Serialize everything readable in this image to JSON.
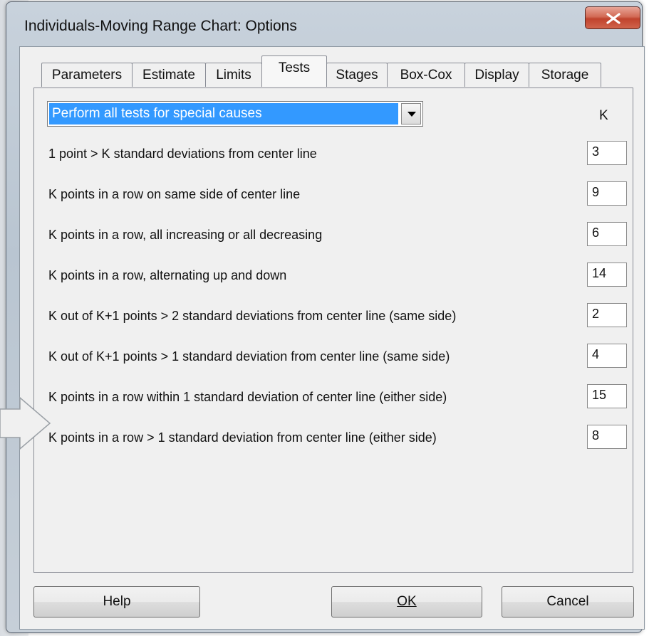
{
  "window": {
    "title": "Individuals-Moving Range Chart: Options"
  },
  "tabs": [
    {
      "label": "Parameters",
      "active": false
    },
    {
      "label": "Estimate",
      "active": false
    },
    {
      "label": "Limits",
      "active": false
    },
    {
      "label": "Tests",
      "active": true
    },
    {
      "label": "Stages",
      "active": false
    },
    {
      "label": "Box-Cox",
      "active": false
    },
    {
      "label": "Display",
      "active": false
    },
    {
      "label": "Storage",
      "active": false
    }
  ],
  "tests_panel": {
    "mode_select": "Perform all tests for special causes",
    "k_header": "K",
    "tests": [
      {
        "label": "1 point > K standard deviations from center line",
        "k": "3"
      },
      {
        "label": "K points in a row on same side of center line",
        "k": "9"
      },
      {
        "label": "K points in a row, all increasing or all decreasing",
        "k": "6"
      },
      {
        "label": "K points in a row, alternating up and down",
        "k": "14"
      },
      {
        "label": "K out of K+1 points > 2 standard deviations from center line (same side)",
        "k": "2"
      },
      {
        "label": "K out of K+1 points > 1 standard deviation from center line (same side)",
        "k": "4"
      },
      {
        "label": "K points in a row within 1 standard deviation of center line (either side)",
        "k": "15"
      },
      {
        "label": "K points in a row > 1 standard deviation from center line (either side)",
        "k": "8"
      }
    ]
  },
  "buttons": {
    "help": "Help",
    "ok": "OK",
    "cancel": "Cancel"
  },
  "colors": {
    "selection": "#3399ff",
    "close_button": "#c8503a"
  }
}
